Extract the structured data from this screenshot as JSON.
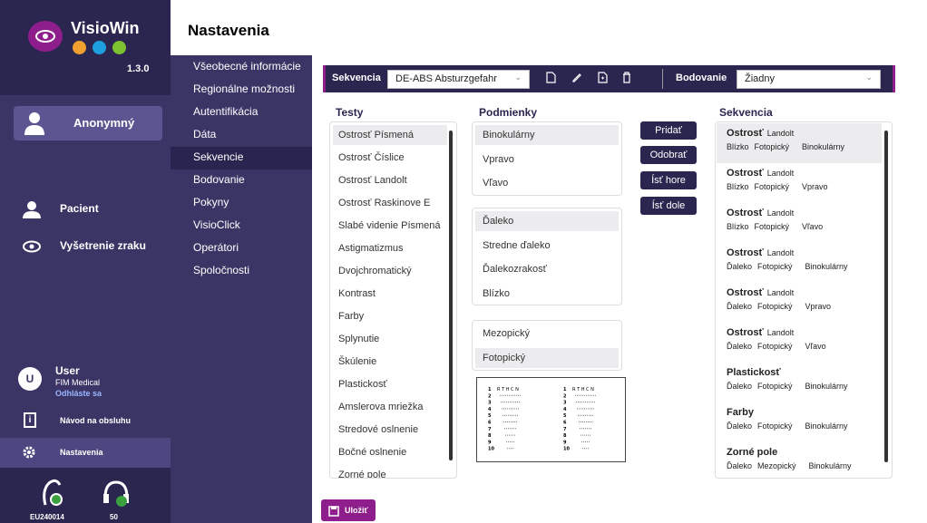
{
  "app": {
    "name": "VisioWin",
    "version": "1.3.0"
  },
  "sidebar": {
    "user_button": "Anonymný",
    "patient": "Pacient",
    "eye_exam": "Vyšetrenie zraku",
    "account": {
      "initial": "U",
      "name": "User",
      "company": "FIM Medical",
      "logout": "Odhláste sa"
    },
    "manual": "Návod na obsluhu",
    "settings": "Nastavenia",
    "devices": [
      {
        "label": "EU240014",
        "icon": "headset-device-icon"
      },
      {
        "label": "50",
        "icon": "headphones-device-icon"
      }
    ]
  },
  "nav": {
    "title": "Nastavenia",
    "items": [
      "Všeobecné informácie",
      "Regionálne možnosti",
      "Autentifikácia",
      "Dáta",
      "Sekvencie",
      "Bodovanie",
      "Pokyny",
      "VisioClick",
      "Operátori",
      "Spoločnosti"
    ],
    "active": "Sekvencie"
  },
  "toolbar": {
    "sequence_label": "Sekvencia",
    "sequence_value": "DE-ABS Absturzgefahr",
    "scoring_label": "Bodovanie",
    "scoring_value": "Žiadny",
    "icons": [
      "new-file-icon",
      "edit-icon",
      "duplicate-icon",
      "delete-icon"
    ]
  },
  "tests": {
    "header": "Testy",
    "items": [
      "Ostrosť Písmená",
      "Ostrosť Číslice",
      "Ostrosť Landolt",
      "Ostrosť Raskinove E",
      "Slabé videnie Písmená",
      "Astigmatizmus",
      "Dvojchromatický",
      "Kontrast",
      "Farby",
      "Splynutie",
      "Škúlenie",
      "Plastickosť",
      "Amslerova mriežka",
      "Stredové oslnenie",
      "Bočné oslnenie",
      "Zorné pole"
    ],
    "selected": 0
  },
  "conditions": {
    "header": "Podmienky",
    "binocular": {
      "items": [
        "Binokulárny",
        "Vpravo",
        "Vľavo"
      ],
      "selected": 0
    },
    "distance": {
      "items": [
        "Ďaleko",
        "Stredne ďaleko",
        "Ďalekozrakosť",
        "Blízko"
      ],
      "selected": 0
    },
    "lighting": {
      "items": [
        "Mezopický",
        "Fotopický"
      ],
      "selected": 1
    },
    "chart": {
      "row_letters": "R T H C N",
      "lines": [
        "1",
        "2",
        "3",
        "4",
        "5",
        "6",
        "7",
        "8",
        "9",
        "10"
      ]
    }
  },
  "actions": {
    "add": "Pridať",
    "remove": "Odobrať",
    "up": "Ísť hore",
    "down": "Ísť dole"
  },
  "sequence": {
    "header": "Sekvencia",
    "items": [
      {
        "test": "Ostrosť",
        "sub": "Landolt",
        "params": [
          "Blízko",
          "Fotopický",
          "Binokulárny"
        ]
      },
      {
        "test": "Ostrosť",
        "sub": "Landolt",
        "params": [
          "Blízko",
          "Fotopický",
          "Vpravo"
        ]
      },
      {
        "test": "Ostrosť",
        "sub": "Landolt",
        "params": [
          "Blízko",
          "Fotopický",
          "Vľavo"
        ]
      },
      {
        "test": "Ostrosť",
        "sub": "Landolt",
        "params": [
          "Ďaleko",
          "Fotopický",
          "Binokulárny"
        ]
      },
      {
        "test": "Ostrosť",
        "sub": "Landolt",
        "params": [
          "Ďaleko",
          "Fotopický",
          "Vpravo"
        ]
      },
      {
        "test": "Ostrosť",
        "sub": "Landolt",
        "params": [
          "Ďaleko",
          "Fotopický",
          "Vľavo"
        ]
      },
      {
        "test": "Plastickosť",
        "sub": "",
        "params": [
          "Ďaleko",
          "Fotopický",
          "Binokulárny"
        ]
      },
      {
        "test": "Farby",
        "sub": "",
        "params": [
          "Ďaleko",
          "Fotopický",
          "Binokulárny"
        ]
      },
      {
        "test": "Zorné pole",
        "sub": "",
        "params": [
          "Ďaleko",
          "Mezopický",
          "Binokulárny"
        ]
      }
    ],
    "selected": 0
  },
  "save": "Uložiť",
  "colors": {
    "sidebar": "#3b3566",
    "dark": "#2b2650",
    "accent": "#8e1e8c",
    "selected": "#ececef"
  }
}
